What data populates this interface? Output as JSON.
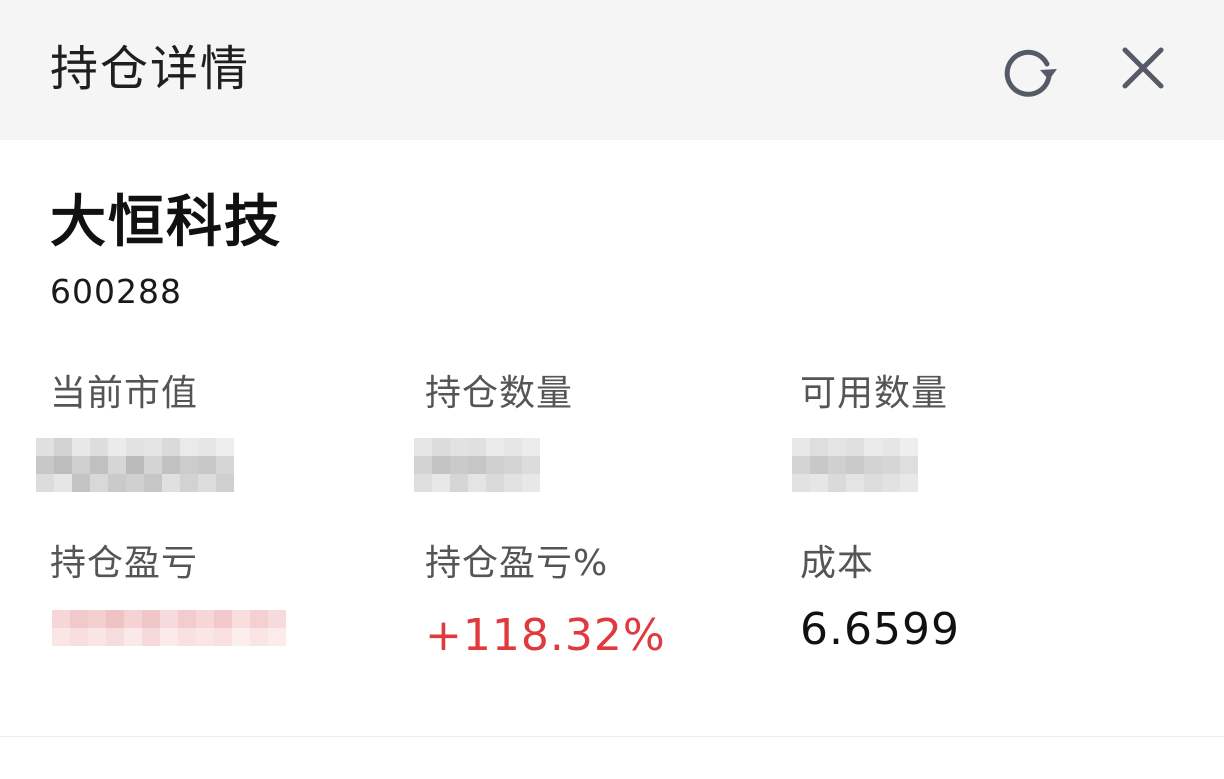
{
  "header": {
    "title": "持仓详情",
    "refresh_icon": "refresh-icon",
    "close_icon": "close-icon"
  },
  "stock": {
    "name": "大恒科技",
    "code": "600288"
  },
  "metrics": {
    "market_value": {
      "label": "当前市值",
      "value": ""
    },
    "position_qty": {
      "label": "持仓数量",
      "value": ""
    },
    "available_qty": {
      "label": "可用数量",
      "value": ""
    },
    "position_pnl": {
      "label": "持仓盈亏",
      "value": ""
    },
    "position_pnl_pct": {
      "label": "持仓盈亏%",
      "value": "+118.32%"
    },
    "cost": {
      "label": "成本",
      "value": "6.6599"
    }
  },
  "colors": {
    "header_bg": "#f5f5f5",
    "profit_red": "#e0393e",
    "icon_gray": "#555b66"
  }
}
